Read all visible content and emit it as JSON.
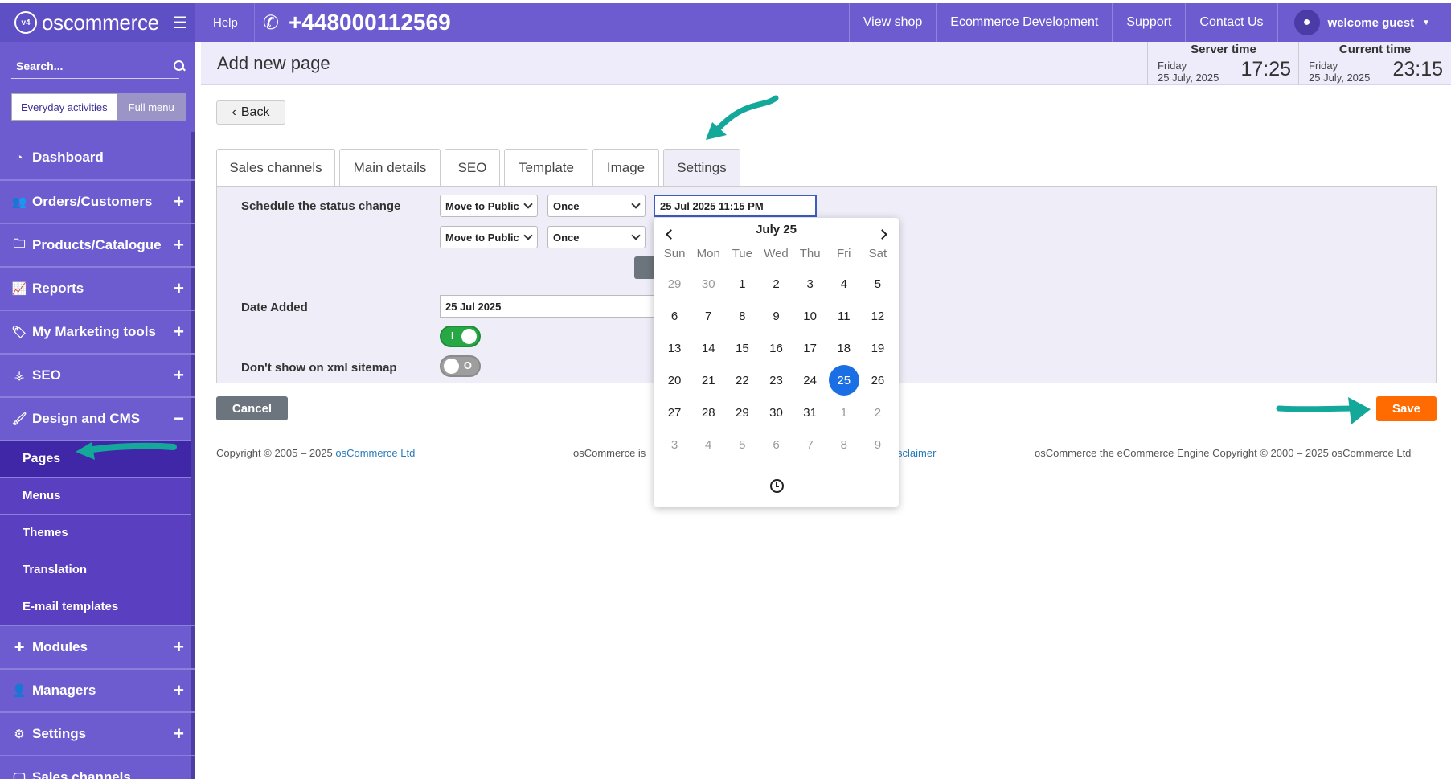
{
  "brand": {
    "name": "oscommerce",
    "badge": "v4"
  },
  "topbar": {
    "help": "Help",
    "phone": "+448000112569",
    "nav": [
      "View shop",
      "Ecommerce Development",
      "Support",
      "Contact Us"
    ],
    "user": "welcome guest"
  },
  "sidebar": {
    "search_placeholder": "Search...",
    "mode_everyday": "Everyday activities",
    "mode_full": "Full menu",
    "items": [
      {
        "label": "Dashboard",
        "icon": "dashboard-icon",
        "expand": ""
      },
      {
        "label": "Orders/Customers",
        "icon": "users-icon",
        "expand": "+"
      },
      {
        "label": "Products/Catalogue",
        "icon": "folder-icon",
        "expand": "+"
      },
      {
        "label": "Reports",
        "icon": "chart-icon",
        "expand": "+"
      },
      {
        "label": "My Marketing tools",
        "icon": "tag-icon",
        "expand": "+"
      },
      {
        "label": "SEO",
        "icon": "sitemap-icon",
        "expand": "+"
      },
      {
        "label": "Design and CMS",
        "icon": "brush-icon",
        "expand": "−"
      }
    ],
    "submenu": [
      "Pages",
      "Menus",
      "Themes",
      "Translation",
      "E-mail templates"
    ],
    "items_after": [
      {
        "label": "Modules",
        "icon": "puzzle-icon",
        "expand": "+"
      },
      {
        "label": "Managers",
        "icon": "user-icon",
        "expand": "+"
      },
      {
        "label": "Settings",
        "icon": "gears-icon",
        "expand": "+"
      },
      {
        "label": "Sales channels",
        "icon": "monitor-icon",
        "expand": ""
      }
    ]
  },
  "header": {
    "title": "Add new page",
    "server_time": {
      "label": "Server time",
      "day": "Friday",
      "date": "25 July, 2025",
      "clock": "17:25"
    },
    "current_time": {
      "label": "Current time",
      "day": "Friday",
      "date": "25 July, 2025",
      "clock": "23:15"
    }
  },
  "content": {
    "back": "Back",
    "tabs": [
      "Sales channels",
      "Main details",
      "SEO",
      "Template",
      "Image",
      "Settings"
    ],
    "active_tab": "Settings",
    "schedule_label": "Schedule the status change",
    "status_select_1": "Move to Public",
    "freq_select_1": "Once",
    "datetime_value": "25 Jul 2025 11:15 PM",
    "status_select_2": "Move to Public",
    "freq_select_2": "Once",
    "date_added_label": "Date Added",
    "date_added_value": "25 Jul 2025",
    "toggle_on_mark": "I",
    "sitemap_label": "Don't show on xml sitemap",
    "toggle_off_mark": "O",
    "cancel": "Cancel",
    "save": "Save"
  },
  "footer": {
    "left_prefix": "Copyright © 2005 – 2025 ",
    "left_link": "osCommerce Ltd",
    "mid_prefix": "osCommerce is",
    "mid_link": "sclaimer",
    "right": "osCommerce the eCommerce Engine Copyright © 2000 – 2025 osCommerce Ltd"
  },
  "datepicker": {
    "title": "July 25",
    "weekdays": [
      "Sun",
      "Mon",
      "Tue",
      "Wed",
      "Thu",
      "Fri",
      "Sat"
    ],
    "weeks": [
      [
        [
          "29",
          1
        ],
        [
          "30",
          1
        ],
        [
          "1",
          0
        ],
        [
          "2",
          0
        ],
        [
          "3",
          0
        ],
        [
          "4",
          0
        ],
        [
          "5",
          0
        ]
      ],
      [
        [
          "6",
          0
        ],
        [
          "7",
          0
        ],
        [
          "8",
          0
        ],
        [
          "9",
          0
        ],
        [
          "10",
          0
        ],
        [
          "11",
          0
        ],
        [
          "12",
          0
        ]
      ],
      [
        [
          "13",
          0
        ],
        [
          "14",
          0
        ],
        [
          "15",
          0
        ],
        [
          "16",
          0
        ],
        [
          "17",
          0
        ],
        [
          "18",
          0
        ],
        [
          "19",
          0
        ]
      ],
      [
        [
          "20",
          0
        ],
        [
          "21",
          0
        ],
        [
          "22",
          0
        ],
        [
          "23",
          0
        ],
        [
          "24",
          0
        ],
        [
          "25",
          2
        ],
        [
          "26",
          0
        ]
      ],
      [
        [
          "27",
          0
        ],
        [
          "28",
          0
        ],
        [
          "29",
          0
        ],
        [
          "30",
          0
        ],
        [
          "31",
          0
        ],
        [
          "1",
          1
        ],
        [
          "2",
          1
        ]
      ],
      [
        [
          "3",
          1
        ],
        [
          "4",
          1
        ],
        [
          "5",
          1
        ],
        [
          "6",
          1
        ],
        [
          "7",
          1
        ],
        [
          "8",
          1
        ],
        [
          "9",
          1
        ]
      ]
    ]
  },
  "colors": {
    "brand": "#6c5ccf",
    "sidebar_sub": "#5a3fc0",
    "save": "#ff6b00",
    "toggle_on": "#28a745",
    "selected_day": "#1b6fe4",
    "annotation": "#14a89a"
  }
}
